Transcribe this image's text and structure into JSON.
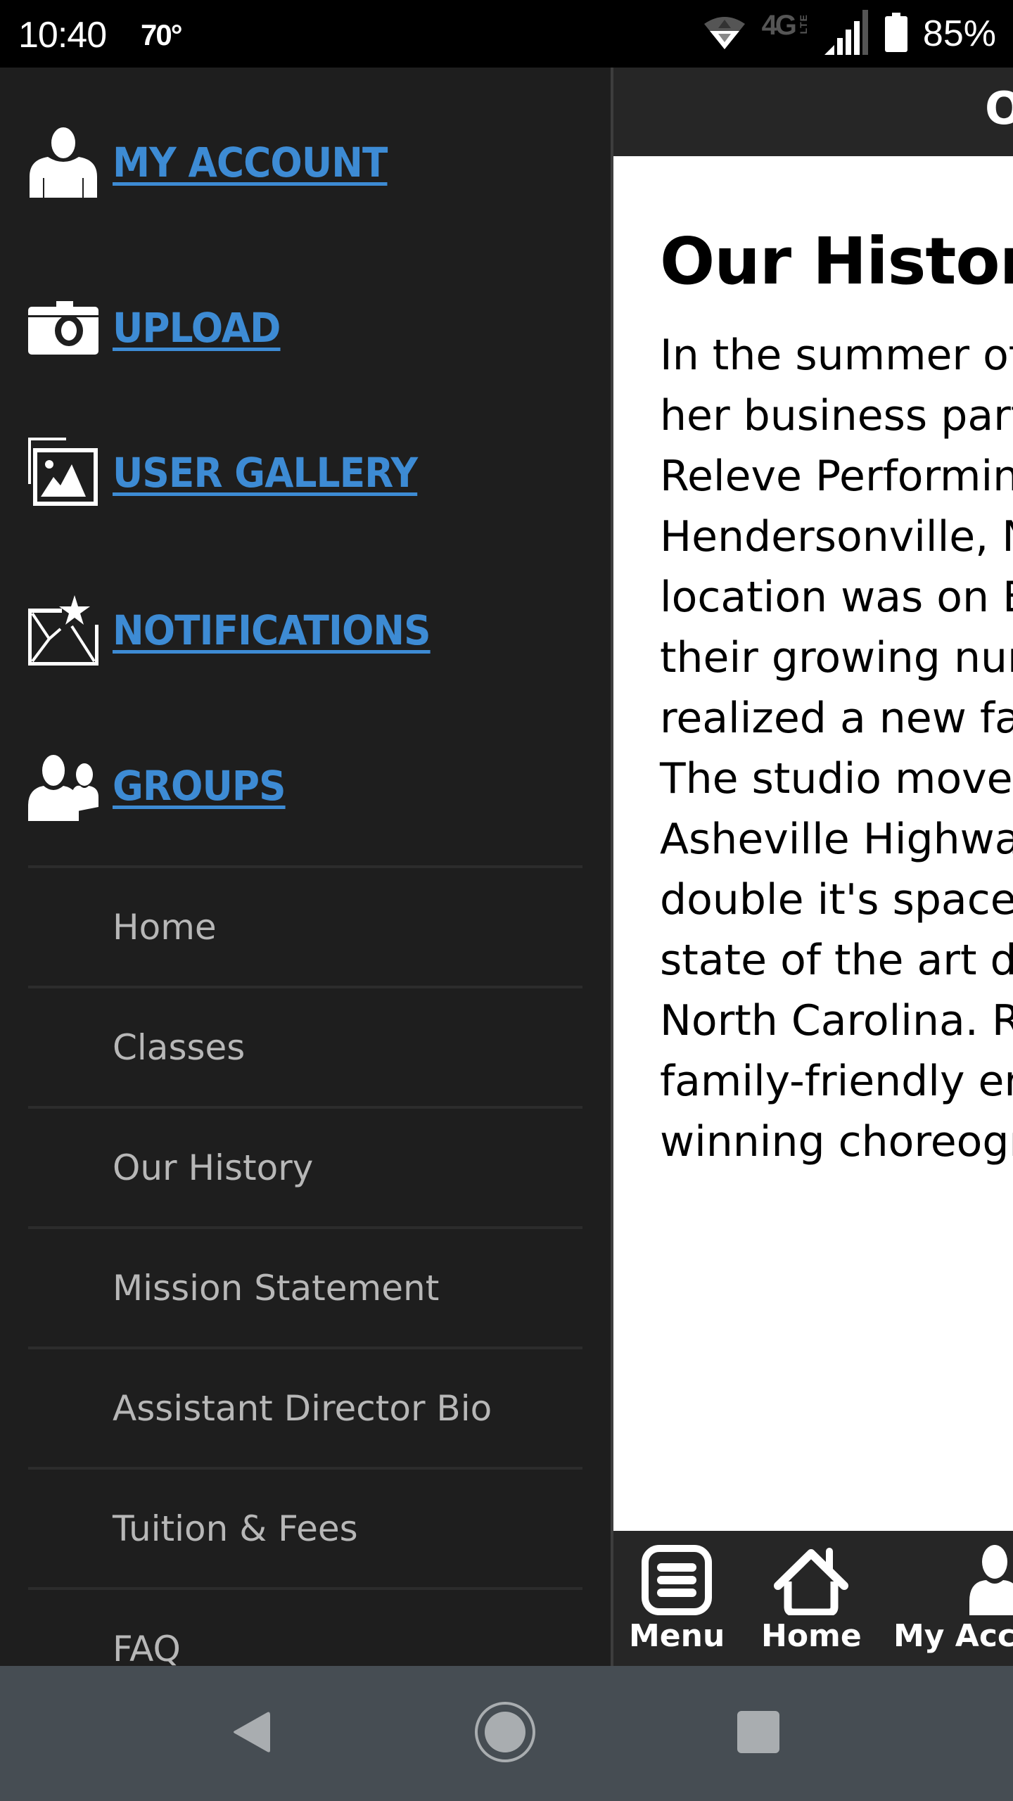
{
  "status_bar": {
    "time": "10:40",
    "temperature": "70°",
    "network": "4G",
    "network_sub": "LTE",
    "battery_percent": "85%",
    "icons": [
      "vpn-icon",
      "4g-lte-icon",
      "signal-icon",
      "battery-icon"
    ]
  },
  "drawer": {
    "primary_links": [
      {
        "label": "MY ACCOUNT",
        "icon": "user-icon"
      },
      {
        "label": "UPLOAD",
        "icon": "camera-icon"
      },
      {
        "label": "USER GALLERY",
        "icon": "gallery-icon"
      },
      {
        "label": "NOTIFICATIONS",
        "icon": "mail-star-icon"
      },
      {
        "label": "GROUPS",
        "icon": "group-icon"
      }
    ],
    "menu_items": [
      {
        "label": "Home"
      },
      {
        "label": "Classes"
      },
      {
        "label": "Our History"
      },
      {
        "label": "Mission Statement"
      },
      {
        "label": "Assistant Director Bio"
      },
      {
        "label": "Tuition & Fees"
      },
      {
        "label": "FAQ"
      }
    ],
    "colors": {
      "link": "#3d8bd4",
      "background": "#1e1e1e",
      "item_text": "#b7b7b7"
    }
  },
  "page": {
    "header_title": "Our History",
    "heading": "Our History",
    "body_lines": [
      "In the summer of",
      "her business part",
      "Releve Performin",
      "Hendersonville, N",
      "location was on B",
      "their growing nun",
      "realized a new fa",
      "The studio moved",
      "Asheville Highwa",
      "double it's space",
      "state of the art da",
      "North Carolina. R",
      "family-friendly en",
      "winning choreogr"
    ]
  },
  "tab_bar": {
    "tabs": [
      {
        "label": "Menu",
        "icon": "menu-icon"
      },
      {
        "label": "Home",
        "icon": "home-icon"
      },
      {
        "label": "My Account",
        "icon": "user-icon"
      }
    ]
  },
  "nav_bar": {
    "buttons": [
      "back",
      "home",
      "recents"
    ]
  }
}
